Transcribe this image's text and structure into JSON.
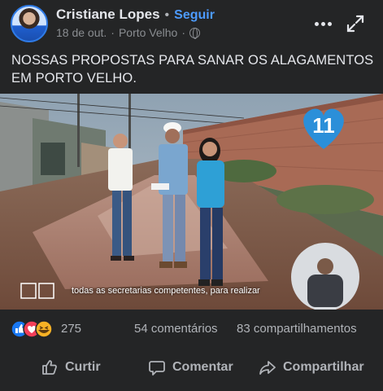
{
  "post": {
    "author": "Cristiane Lopes",
    "separator": "•",
    "follow_label": "Seguir",
    "date": "18 de out.",
    "meta_separator": "·",
    "location": "Porto Velho",
    "meta_separator_2": "·",
    "caption": "NOSSAS PROPOSTAS PARA SANAR OS ALAGAMENTOS EM PORTO VELHO.",
    "video_subtitle": "todas as secretarias competentes, para realizar",
    "video_badge_number": "11"
  },
  "stats": {
    "reaction_count": "275",
    "comments": "54 comentários",
    "shares": "83 compartilhamentos"
  },
  "actions": {
    "like": "Curtir",
    "comment": "Comentar",
    "share": "Compartilhar"
  },
  "icons": {
    "more": "more-horizontal-icon",
    "expand": "expand-icon",
    "privacy": "globe-icon",
    "like": "thumbs-up-icon",
    "comment": "comment-bubble-icon",
    "share": "share-arrow-icon"
  },
  "colors": {
    "background": "#242526",
    "text": "#e4e6eb",
    "muted": "#b0b3b8",
    "link": "#4d9bff",
    "like_blue": "#1877f2",
    "love_red": "#f33e58",
    "haha_yellow": "#f7b125"
  }
}
